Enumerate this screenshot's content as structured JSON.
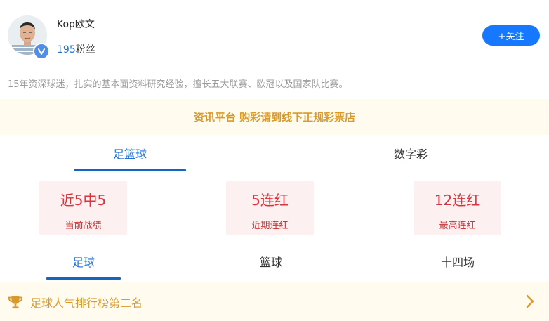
{
  "profile": {
    "username": "Kop欧文",
    "fans_count": "195",
    "fans_label": "粉丝",
    "follow_label": "+关注",
    "bio": "15年资深球迷，扎实的基本面资料研究经验，擅长五大联赛、欧冠以及国家队比赛。"
  },
  "notice": {
    "text": "资讯平台 购彩请到线下正规彩票店"
  },
  "main_tabs": [
    {
      "label": "足篮球",
      "active": true
    },
    {
      "label": "数字彩",
      "active": false
    }
  ],
  "stats": [
    {
      "value": "近5中5",
      "label": "当前战绩"
    },
    {
      "value": "5连红",
      "label": "近期连红"
    },
    {
      "value": "12连红",
      "label": "最高连红"
    }
  ],
  "sub_tabs": [
    {
      "label": "足球",
      "active": true
    },
    {
      "label": "篮球",
      "active": false
    },
    {
      "label": "十四场",
      "active": false
    }
  ],
  "rank": {
    "text": "足球人气排行榜第二名",
    "icon": "trophy-icon"
  },
  "colors": {
    "accent_blue": "#1677ff",
    "link_blue": "#1e6fd9",
    "stat_red": "#d9343c",
    "gold": "#d99a2b",
    "cream": "#fffbef"
  }
}
